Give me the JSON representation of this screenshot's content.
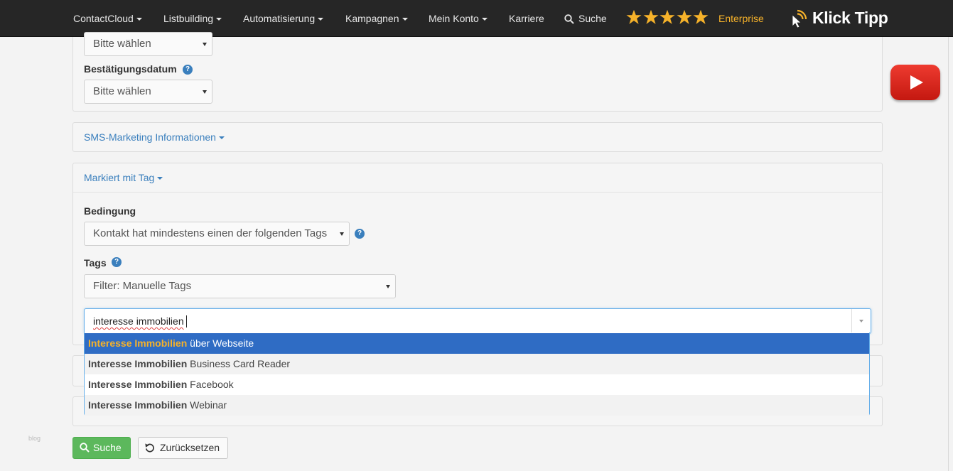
{
  "nav": {
    "items": [
      {
        "label": "ContactCloud",
        "dropdown": true
      },
      {
        "label": "Listbuilding",
        "dropdown": true
      },
      {
        "label": "Automatisierung",
        "dropdown": true
      },
      {
        "label": "Kampagnen",
        "dropdown": true
      },
      {
        "label": "Mein Konto",
        "dropdown": true
      },
      {
        "label": "Karriere",
        "dropdown": false
      }
    ],
    "search_label": "Suche",
    "rating_stars": 5,
    "plan_label": "Enterprise",
    "logo_text": "Klick Tipp"
  },
  "colors": {
    "navbar_bg": "#262626",
    "accent_gold": "#f6b22a",
    "link_blue": "#3a7fbd",
    "highlight_blue": "#2f6cc4",
    "success_green": "#5cb85c"
  },
  "form": {
    "top_select_value": "Bitte wählen",
    "confirmation_date": {
      "label": "Bestätigungsdatum",
      "help_icon": "?",
      "select_value": "Bitte wählen"
    },
    "sms_section_label": "SMS-Marketing Informationen",
    "tag_section": {
      "label": "Markiert mit Tag",
      "condition_label": "Bedingung",
      "condition_value": "Kontakt hat mindestens einen der folgenden Tags",
      "tags_label": "Tags",
      "tags_filter_value": "Filter: Manuelle Tags",
      "tag_search_value": "interesse immobilien",
      "suggestions": [
        {
          "match": "Interesse Immobilien",
          "rest": " über Webseite",
          "highlighted": true
        },
        {
          "match": "Interesse Immobilien",
          "rest": " Business Card Reader",
          "highlighted": false
        },
        {
          "match": "Interesse Immobilien",
          "rest": " Facebook",
          "highlighted": false
        },
        {
          "match": "Interesse Immobilien",
          "rest": " Webinar",
          "highlighted": false
        }
      ]
    }
  },
  "buttons": {
    "search_label": "Suche",
    "reset_label": "Zurücksetzen"
  },
  "watermark": "blog"
}
